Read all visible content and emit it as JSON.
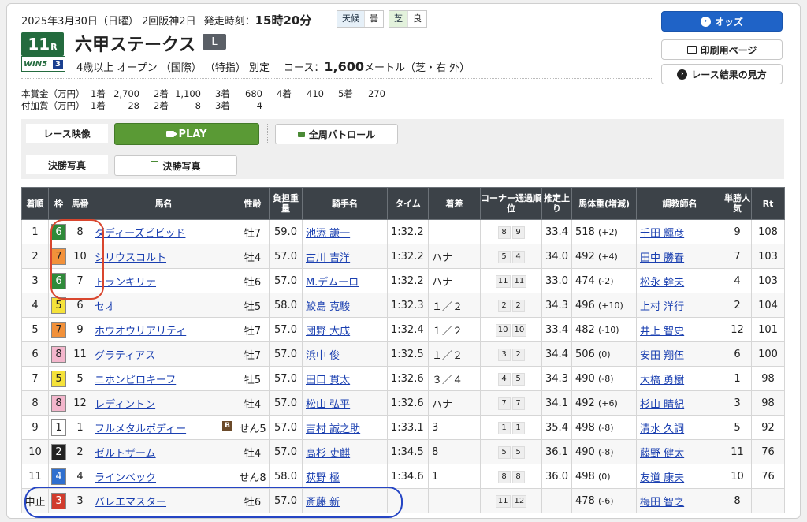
{
  "header": {
    "date": "2025年3月30日（日曜） 2回阪神2日",
    "start_label": "発走時刻：",
    "start_time": "15時20分",
    "weather_label": "天候",
    "weather_value": "曇",
    "track_label": "芝",
    "track_value": "良",
    "race_number": "11",
    "race_suffix": "R",
    "win5_label": "WIN5",
    "win5_number": "3",
    "race_name": "六甲ステークス",
    "grade": "L",
    "conditions": "4歳以上 オープン （国際） （特指） 別定",
    "course_label": "コース：",
    "distance": "1,600",
    "course_detail": "メートル（芝・右 外）"
  },
  "prizes": {
    "main_label": "本賞金（万円）",
    "main": [
      {
        "place": "1着",
        "amount": "2,700"
      },
      {
        "place": "2着",
        "amount": "1,100"
      },
      {
        "place": "3着",
        "amount": "680"
      },
      {
        "place": "4着",
        "amount": "410"
      },
      {
        "place": "5着",
        "amount": "270"
      }
    ],
    "extra_label": "付加賞（万円）",
    "extra": [
      {
        "place": "1着",
        "amount": "28"
      },
      {
        "place": "2着",
        "amount": "8"
      },
      {
        "place": "3着",
        "amount": "4"
      }
    ]
  },
  "actions": {
    "odds": "オッズ",
    "print": "印刷用ページ",
    "guide": "レース結果の見方"
  },
  "media": {
    "video_label": "レース映像",
    "play": "PLAY",
    "patrol": "全周パトロール",
    "photo_label": "決勝写真",
    "photo_button": "決勝写真"
  },
  "colors": {
    "waku": {
      "1": "#ffffff",
      "2": "#222222",
      "3": "#d13b2c",
      "4": "#2f6fcf",
      "5": "#f5e23a",
      "6": "#2f8a3a",
      "7": "#f2913a",
      "8": "#f3b6cc"
    },
    "accent_blue": "#1f63c7",
    "play_green": "#5a9a35"
  },
  "table": {
    "headers": [
      "着順",
      "枠",
      "馬番",
      "馬名",
      "性齢",
      "負担重量",
      "騎手名",
      "タイム",
      "着差",
      "コーナー通過順位",
      "推定上り",
      "馬体重(増減)",
      "調教師名",
      "単勝人気",
      "Rt"
    ],
    "rows": [
      {
        "rank": "1",
        "waku": "6",
        "num": "8",
        "horse": "ダディーズビビッド",
        "sex_age": "牡7",
        "weight": "59.0",
        "jockey": "池添 謙一",
        "time": "1:32.2",
        "margin": "",
        "corner": [
          "8",
          "9"
        ],
        "last": "33.4",
        "body": "518",
        "diff": "(+2)",
        "trainer": "千田 輝彦",
        "pop": "9",
        "rt": "108",
        "b": ""
      },
      {
        "rank": "2",
        "waku": "7",
        "num": "10",
        "horse": "シリウスコルト",
        "sex_age": "牡4",
        "weight": "57.0",
        "jockey": "古川 吉洋",
        "time": "1:32.2",
        "margin": "ハナ",
        "corner": [
          "5",
          "4"
        ],
        "last": "34.0",
        "body": "492",
        "diff": "(+4)",
        "trainer": "田中 勝春",
        "pop": "7",
        "rt": "103",
        "b": ""
      },
      {
        "rank": "3",
        "waku": "6",
        "num": "7",
        "horse": "トランキリテ",
        "sex_age": "牡6",
        "weight": "57.0",
        "jockey": "M.デムーロ",
        "time": "1:32.2",
        "margin": "ハナ",
        "corner": [
          "11",
          "11"
        ],
        "last": "33.0",
        "body": "474",
        "diff": "(-2)",
        "trainer": "松永 幹夫",
        "pop": "4",
        "rt": "103",
        "b": ""
      },
      {
        "rank": "4",
        "waku": "5",
        "num": "6",
        "horse": "セオ",
        "sex_age": "牡5",
        "weight": "58.0",
        "jockey": "鮫島 克駿",
        "time": "1:32.3",
        "margin": "１／２",
        "corner": [
          "2",
          "2"
        ],
        "last": "34.3",
        "body": "496",
        "diff": "(+10)",
        "trainer": "上村 洋行",
        "pop": "2",
        "rt": "104",
        "b": ""
      },
      {
        "rank": "5",
        "waku": "7",
        "num": "9",
        "horse": "ホウオウリアリティ",
        "sex_age": "牡7",
        "weight": "57.0",
        "jockey": "団野 大成",
        "time": "1:32.4",
        "margin": "１／２",
        "corner": [
          "10",
          "10"
        ],
        "last": "33.4",
        "body": "482",
        "diff": "(-10)",
        "trainer": "井上 智史",
        "pop": "12",
        "rt": "101",
        "b": ""
      },
      {
        "rank": "6",
        "waku": "8",
        "num": "11",
        "horse": "グラティアス",
        "sex_age": "牡7",
        "weight": "57.0",
        "jockey": "浜中 俊",
        "time": "1:32.5",
        "margin": "１／２",
        "corner": [
          "3",
          "2"
        ],
        "last": "34.4",
        "body": "506",
        "diff": "(0)",
        "trainer": "安田 翔伍",
        "pop": "6",
        "rt": "100",
        "b": ""
      },
      {
        "rank": "7",
        "waku": "5",
        "num": "5",
        "horse": "ニホンピロキーフ",
        "sex_age": "牡5",
        "weight": "57.0",
        "jockey": "田口 貫太",
        "time": "1:32.6",
        "margin": "３／４",
        "corner": [
          "4",
          "5"
        ],
        "last": "34.3",
        "body": "490",
        "diff": "(-8)",
        "trainer": "大橋 勇樹",
        "pop": "1",
        "rt": "98",
        "b": ""
      },
      {
        "rank": "8",
        "waku": "8",
        "num": "12",
        "horse": "レディントン",
        "sex_age": "牡4",
        "weight": "57.0",
        "jockey": "松山 弘平",
        "time": "1:32.6",
        "margin": "ハナ",
        "corner": [
          "7",
          "7"
        ],
        "last": "34.1",
        "body": "492",
        "diff": "(+6)",
        "trainer": "杉山 晴紀",
        "pop": "3",
        "rt": "98",
        "b": ""
      },
      {
        "rank": "9",
        "waku": "1",
        "num": "1",
        "horse": "フルメタルボディー",
        "sex_age": "せん5",
        "weight": "57.0",
        "jockey": "吉村 誠之助",
        "time": "1:33.1",
        "margin": "3",
        "corner": [
          "1",
          "1"
        ],
        "last": "35.4",
        "body": "498",
        "diff": "(-8)",
        "trainer": "清水 久詞",
        "pop": "5",
        "rt": "92",
        "b": "B"
      },
      {
        "rank": "10",
        "waku": "2",
        "num": "2",
        "horse": "ゼルトザーム",
        "sex_age": "牡4",
        "weight": "57.0",
        "jockey": "高杉 吏麒",
        "time": "1:34.5",
        "margin": "8",
        "corner": [
          "5",
          "5"
        ],
        "last": "36.1",
        "body": "490",
        "diff": "(-8)",
        "trainer": "藤野 健太",
        "pop": "11",
        "rt": "76",
        "b": ""
      },
      {
        "rank": "11",
        "waku": "4",
        "num": "4",
        "horse": "ラインベック",
        "sex_age": "せん8",
        "weight": "58.0",
        "jockey": "荻野 極",
        "time": "1:34.6",
        "margin": "1",
        "corner": [
          "8",
          "8"
        ],
        "last": "36.0",
        "body": "498",
        "diff": "(0)",
        "trainer": "友道 康夫",
        "pop": "10",
        "rt": "76",
        "b": ""
      },
      {
        "rank": "中止",
        "waku": "3",
        "num": "3",
        "horse": "バレエマスター",
        "sex_age": "牡6",
        "weight": "57.0",
        "jockey": "斎藤 新",
        "time": "",
        "margin": "",
        "corner": [
          "11",
          "12"
        ],
        "last": "",
        "body": "478",
        "diff": "(-6)",
        "trainer": "梅田 智之",
        "pop": "8",
        "rt": "",
        "b": ""
      }
    ]
  }
}
